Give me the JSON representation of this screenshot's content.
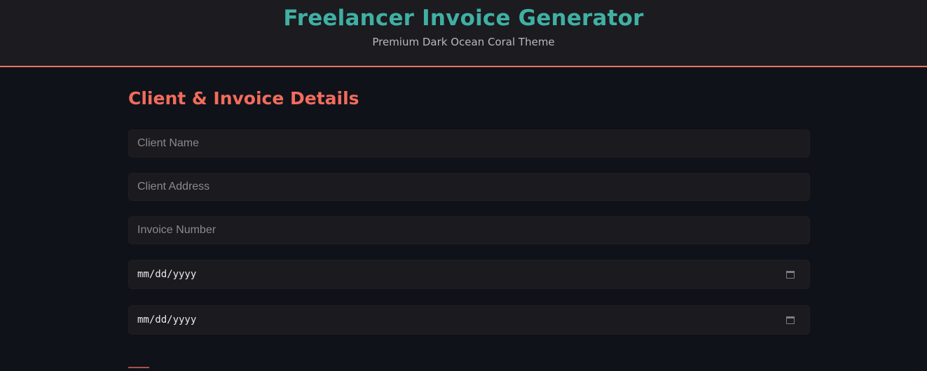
{
  "header": {
    "title": "Freelancer Invoice Generator",
    "subtitle": "Premium Dark Ocean Coral Theme"
  },
  "form": {
    "section_title": "Client & Invoice Details",
    "client_name": {
      "placeholder": "Client Name",
      "value": ""
    },
    "client_address": {
      "placeholder": "Client Address",
      "value": ""
    },
    "invoice_number": {
      "placeholder": "Invoice Number",
      "value": ""
    },
    "invoice_date": {
      "display": "mm/dd/yyyy",
      "icon": "calendar-icon"
    },
    "due_date": {
      "display": "mm/dd/yyyy",
      "icon": "calendar-icon"
    }
  },
  "colors": {
    "accent_teal": "#3fb0a3",
    "accent_coral": "#f26c5c",
    "background": "#10121a",
    "header_bg": "#1c1b20",
    "field_bg": "#1b1a1f"
  }
}
